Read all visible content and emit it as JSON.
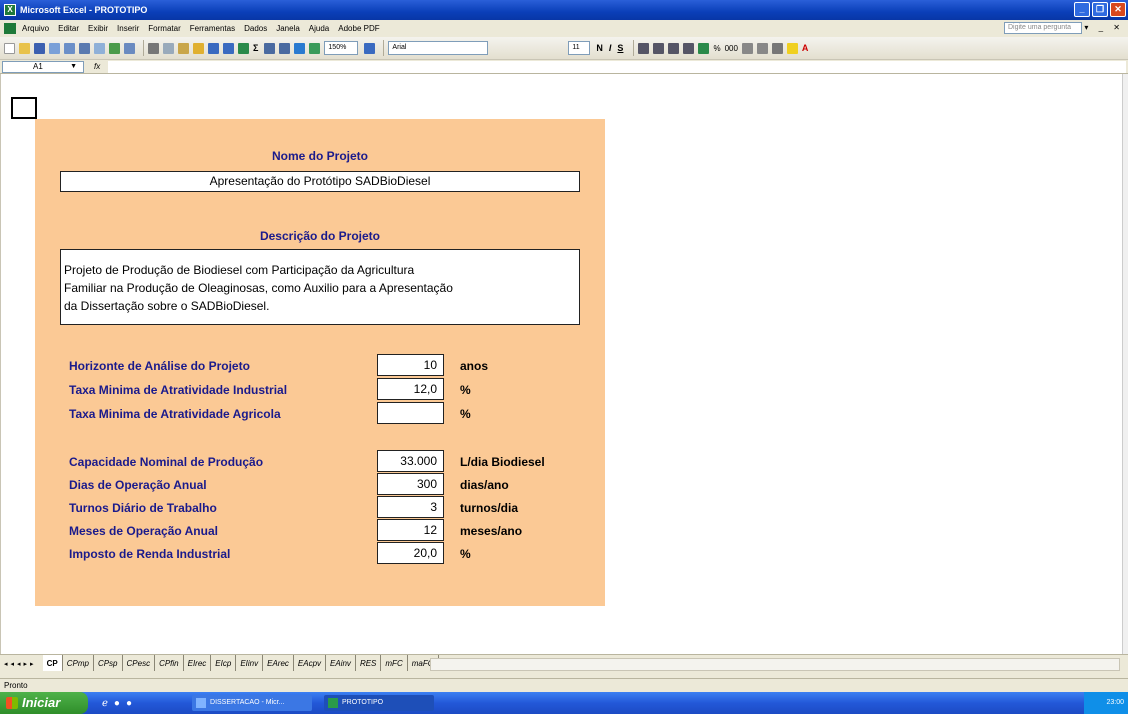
{
  "window": {
    "title": "Microsoft Excel - PROTOTIPO",
    "icon": "excel-icon",
    "controls": [
      "minimize",
      "restore",
      "close"
    ]
  },
  "menu": {
    "items": [
      "Arquivo",
      "Editar",
      "Exibir",
      "Inserir",
      "Formatar",
      "Ferramentas",
      "Dados",
      "Janela",
      "Ajuda",
      "Adobe PDF"
    ],
    "help_placeholder": "Digite uma pergunta"
  },
  "toolbar": {
    "zoom": "150%",
    "font_name": "Arial",
    "font_size": "11",
    "bold": "N",
    "italic": "I",
    "underline": "S",
    "percent": "%",
    "thousands": "000"
  },
  "formula_bar": {
    "name_box": "A1",
    "fx_label": "fx",
    "formula": ""
  },
  "sheet": {
    "project_name_title": "Nome do Projeto",
    "project_name": "Apresentação do Protótipo SADBioDiesel",
    "project_desc_title": "Descrição do Projeto",
    "project_desc_lines": [
      "Projeto de Produção de Biodiesel com Participação da Agricultura",
      "Familiar na Produção de Oleaginosas, como Auxilio para a Apresentação",
      "da Dissertação sobre o SADBioDiesel."
    ],
    "group1": [
      {
        "label": "Horizonte de Análise do Projeto",
        "value": "10",
        "unit": "anos"
      },
      {
        "label": "Taxa Minima de Atratividade Industrial",
        "value": "12,0",
        "unit": "%"
      },
      {
        "label": "Taxa Minima de Atratividade Agricola",
        "value": "",
        "unit": "%"
      }
    ],
    "group2": [
      {
        "label": "Capacidade Nominal de Produção",
        "value": "33.000",
        "unit": "L/dia Biodiesel"
      },
      {
        "label": "Dias de Operação Anual",
        "value": "300",
        "unit": "dias/ano"
      },
      {
        "label": "Turnos Diário de Trabalho",
        "value": "3",
        "unit": "turnos/dia"
      },
      {
        "label": "Meses de Operação Anual",
        "value": "12",
        "unit": "meses/ano"
      },
      {
        "label": "Imposto de Renda Industrial",
        "value": "20,0",
        "unit": "%"
      }
    ],
    "colors": {
      "panel": "#fbc995",
      "label": "#1a1a8c"
    }
  },
  "sheet_tabs": {
    "active": "CP",
    "tabs": [
      "CP",
      "CPmp",
      "CPsp",
      "CPesc",
      "CPfin",
      "EIrec",
      "EIcp",
      "EIinv",
      "EArec",
      "EAcpv",
      "EAinv",
      "RES",
      "mFC",
      "maFC"
    ]
  },
  "status": {
    "text": "Pronto"
  },
  "taskbar": {
    "start_label": "Iniciar",
    "items": [
      {
        "label": "DISSERTACAO - Micr...",
        "active": false
      },
      {
        "label": "PROTOTIPO",
        "active": true
      }
    ],
    "clock": "23:00"
  }
}
